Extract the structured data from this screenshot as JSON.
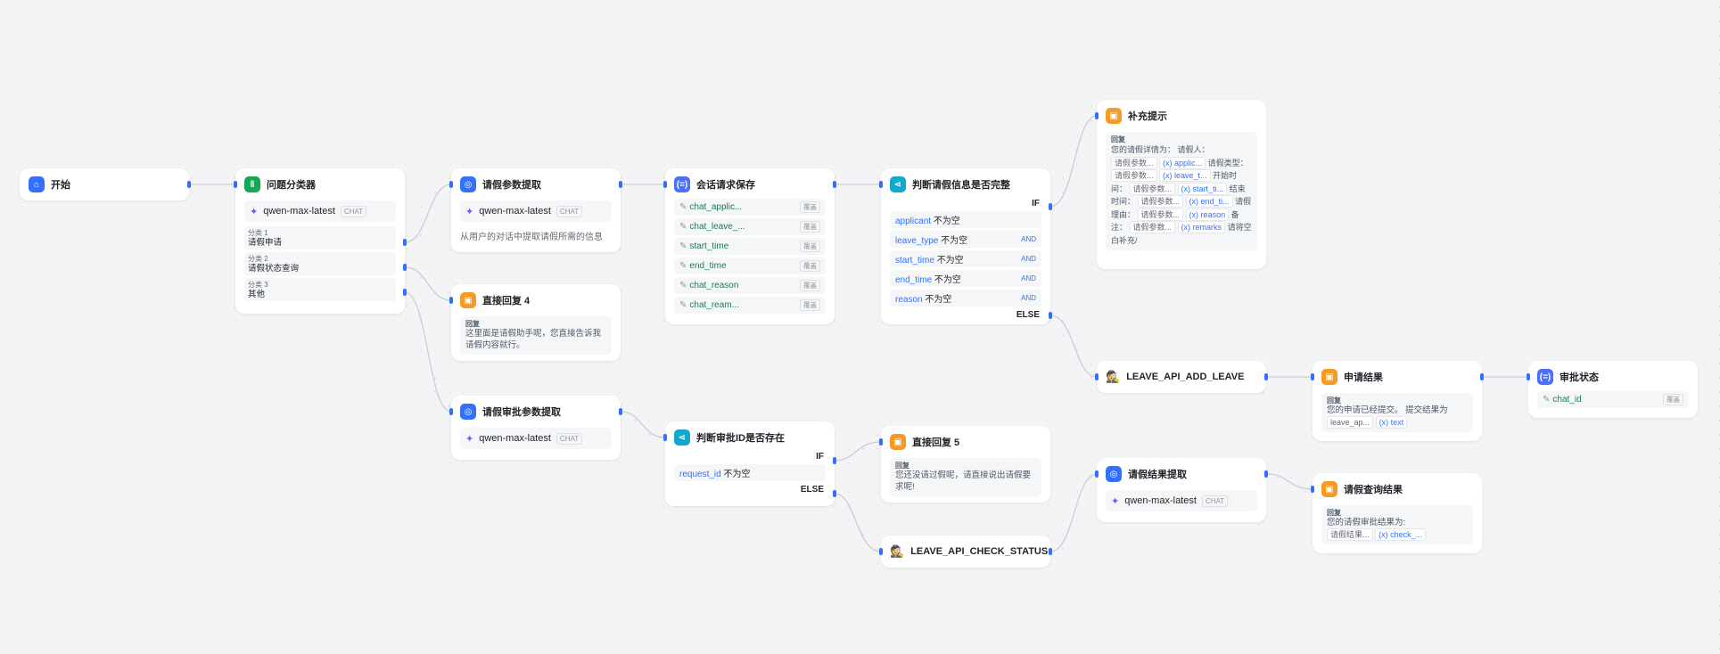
{
  "canvas": {
    "accent": "#3370ff"
  },
  "nodes": {
    "start": {
      "title": "开始",
      "icon": "home-icon"
    },
    "classifier": {
      "title": "问题分类器",
      "model": "qwen-max-latest",
      "model_tag": "CHAT",
      "classes": [
        {
          "key": "分类 1",
          "value": "请假申请"
        },
        {
          "key": "分类 2",
          "value": "请假状态查询"
        },
        {
          "key": "分类 3",
          "value": "其他"
        }
      ]
    },
    "param_extract": {
      "title": "请假参数提取",
      "model": "qwen-max-latest",
      "model_tag": "CHAT",
      "desc": "从用户的对话中提取请假所需的信息"
    },
    "session_save": {
      "title": "会话请求保存",
      "override_label": "覆盖",
      "vars": [
        "chat_applic...",
        "chat_leave_...",
        "start_time",
        "end_time",
        "chat_reason",
        "chat_ream..."
      ]
    },
    "judge_complete": {
      "title": "判断请假信息是否完整",
      "if_label": "IF",
      "else_label": "ELSE",
      "conditions": [
        {
          "var": "applicant",
          "op": "不为空",
          "join": ""
        },
        {
          "var": "leave_type",
          "op": "不为空",
          "join": "AND"
        },
        {
          "var": "start_time",
          "op": "不为空",
          "join": "AND"
        },
        {
          "var": "end_time",
          "op": "不为空",
          "join": "AND"
        },
        {
          "var": "reason",
          "op": "不为空",
          "join": "AND"
        }
      ]
    },
    "supplement": {
      "title": "补充提示",
      "reply_key": "回复",
      "reply": {
        "t1": "您的请假详情为： 请假人：",
        "c1": "请假参数...",
        "v1": "(x) applic...",
        "t2": "请假类型：",
        "c2": "请假参数...",
        "v2": "(x) leave_t...",
        "t3": "开始时间：",
        "c3": "请假参数...",
        "v3": "(x) start_ti...",
        "t4": "结束时间：",
        "c4": "请假参数...",
        "v4": "(x) end_ti...",
        "t5": "请假理由：",
        "c5": "请假参数...",
        "v5": "(x) reason",
        "t6": "备注：",
        "c6": "请假参数...",
        "v6": "(x) remarks",
        "t7": "请将空白补充/"
      }
    },
    "direct_reply4": {
      "title": "直接回复 4",
      "reply_key": "回复",
      "reply": "这里面是请假助手呢，您直接告诉我请假内容就行。"
    },
    "approval_extract": {
      "title": "请假审批参数提取",
      "model": "qwen-max-latest",
      "model_tag": "CHAT"
    },
    "judge_id": {
      "title": "判断审批ID是否存在",
      "if_label": "IF",
      "else_label": "ELSE",
      "conditions": [
        {
          "var": "request_id",
          "op": "不为空"
        }
      ]
    },
    "direct_reply5": {
      "title": "直接回复 5",
      "reply_key": "回复",
      "reply": "您还没请过假呢，请直接说出请假要求呢!"
    },
    "api_add": {
      "title": "LEAVE_API_ADD_LEAVE"
    },
    "api_check": {
      "title": "LEAVE_API_CHECK_STATUS"
    },
    "apply_result": {
      "title": "申请结果",
      "reply_key": "回复",
      "reply": "您的申请已经提交。 提交结果为",
      "chip": "leave_ap...",
      "var": "(x) text"
    },
    "approval_status": {
      "title": "审批状态",
      "var": "chat_id",
      "override_label": "覆盖"
    },
    "result_extract": {
      "title": "请假结果提取",
      "model": "qwen-max-latest",
      "model_tag": "CHAT"
    },
    "query_result": {
      "title": "请假查询结果",
      "reply_key": "回复",
      "reply": "您的请假审批结果为:",
      "chip": "请假结果...",
      "var": "(x) check_..."
    }
  }
}
